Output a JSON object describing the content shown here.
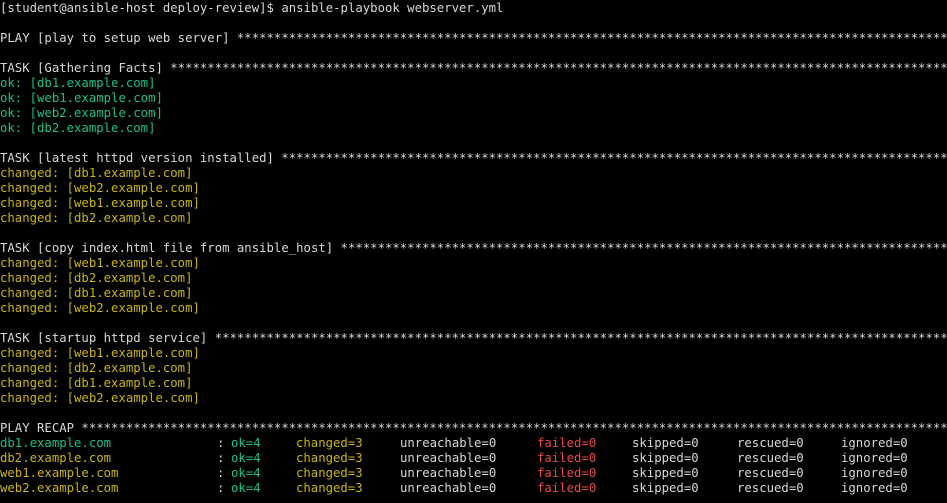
{
  "prompt": {
    "text": "[student@ansible-host deploy-review]$ ansible-playbook webserver.yml"
  },
  "play": {
    "header": "PLAY [play to setup web server] *********************************************************************************************************************************************************************"
  },
  "tasks": [
    {
      "header": "TASK [Gathering Facts] ******************************************************************************************************************************************************************************",
      "results": [
        {
          "status": "ok",
          "text": "ok: [db1.example.com]"
        },
        {
          "status": "ok",
          "text": "ok: [web1.example.com]"
        },
        {
          "status": "ok",
          "text": "ok: [web2.example.com]"
        },
        {
          "status": "ok",
          "text": "ok: [db2.example.com]"
        }
      ]
    },
    {
      "header": "TASK [latest httpd version installed] ***************************************************************************************************************************************************************",
      "results": [
        {
          "status": "changed",
          "text": "changed: [db1.example.com]"
        },
        {
          "status": "changed",
          "text": "changed: [web2.example.com]"
        },
        {
          "status": "changed",
          "text": "changed: [web1.example.com]"
        },
        {
          "status": "changed",
          "text": "changed: [db2.example.com]"
        }
      ]
    },
    {
      "header": "TASK [copy index.html file from ansible_host] ***********************************************************************************************************************************************************",
      "results": [
        {
          "status": "changed",
          "text": "changed: [web1.example.com]"
        },
        {
          "status": "changed",
          "text": "changed: [db2.example.com]"
        },
        {
          "status": "changed",
          "text": "changed: [db1.example.com]"
        },
        {
          "status": "changed",
          "text": "changed: [web2.example.com]"
        }
      ]
    },
    {
      "header": "TASK [startup httpd service] ********************************************************************************************************************************************************************",
      "results": [
        {
          "status": "changed",
          "text": "changed: [web1.example.com]"
        },
        {
          "status": "changed",
          "text": "changed: [db2.example.com]"
        },
        {
          "status": "changed",
          "text": "changed: [db1.example.com]"
        },
        {
          "status": "changed",
          "text": "changed: [web2.example.com]"
        }
      ]
    }
  ],
  "recap": {
    "header": "PLAY RECAP **********************************************************************************************************************************************************************************************",
    "rows": [
      {
        "host": "db1.example.com",
        "sep": ":",
        "ok": "ok=4",
        "changed": "changed=3",
        "unreachable": "unreachable=0",
        "failed": "failed=0",
        "skipped": "skipped=0",
        "rescued": "rescued=0",
        "ignored": "ignored=0"
      },
      {
        "host": "db2.example.com",
        "sep": ":",
        "ok": "ok=4",
        "changed": "changed=3",
        "unreachable": "unreachable=0",
        "failed": "failed=0",
        "skipped": "skipped=0",
        "rescued": "rescued=0",
        "ignored": "ignored=0"
      },
      {
        "host": "web1.example.com",
        "sep": ":",
        "ok": "ok=4",
        "changed": "changed=3",
        "unreachable": "unreachable=0",
        "failed": "failed=0",
        "skipped": "skipped=0",
        "rescued": "rescued=0",
        "ignored": "ignored=0"
      },
      {
        "host": "web2.example.com",
        "sep": ":",
        "ok": "ok=4",
        "changed": "changed=3",
        "unreachable": "unreachable=0",
        "failed": "failed=0",
        "skipped": "skipped=0",
        "rescued": "rescued=0",
        "ignored": "ignored=0"
      }
    ]
  },
  "colors": {
    "background": "#000000",
    "text": "#d8d8d8",
    "ok": "#1dbf8a",
    "changed": "#c9b513",
    "failed": "#e5484d"
  }
}
